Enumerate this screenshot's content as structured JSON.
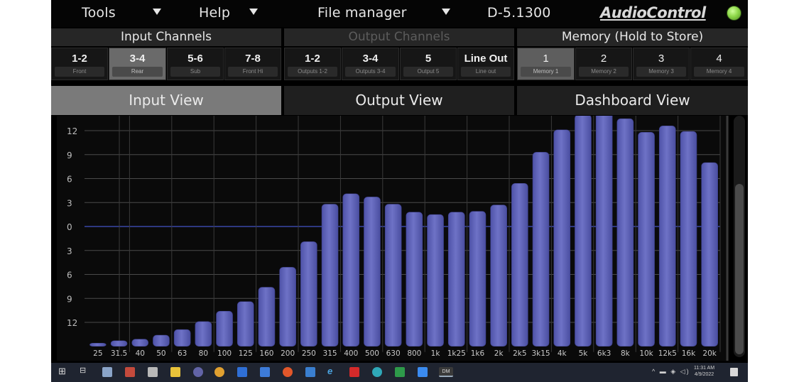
{
  "menu": {
    "tools": "Tools",
    "help": "Help",
    "file_manager": "File manager",
    "device": "D-5.1300",
    "brand": "AudioControl"
  },
  "sections": {
    "input": "Input Channels",
    "output": "Output Channels",
    "memory": "Memory (Hold to Store)"
  },
  "input_channels": [
    {
      "label": "1-2",
      "sub": "Front"
    },
    {
      "label": "3-4",
      "sub": "Rear"
    },
    {
      "label": "5-6",
      "sub": "Sub"
    },
    {
      "label": "7-8",
      "sub": "Front Hi"
    }
  ],
  "output_channels": [
    {
      "label": "1-2",
      "sub": "Outputs 1-2"
    },
    {
      "label": "3-4",
      "sub": "Outputs 3-4"
    },
    {
      "label": "5",
      "sub": "Output 5"
    },
    {
      "label": "Line Out",
      "sub": "Line out"
    }
  ],
  "memory_slots": [
    {
      "label": "1",
      "sub": "Memory 1"
    },
    {
      "label": "2",
      "sub": "Memory 2"
    },
    {
      "label": "3",
      "sub": "Memory 3"
    },
    {
      "label": "4",
      "sub": "Memory 4"
    }
  ],
  "views": {
    "input": "Input View",
    "output": "Output View",
    "dashboard": "Dashboard View"
  },
  "colors": {
    "bar": "#6e72c6",
    "zero_line": "#3b47a8",
    "grid": "#4a4a4a",
    "led": "#8fd94a"
  },
  "chart_data": {
    "type": "bar",
    "categories": [
      "25",
      "31.5",
      "40",
      "50",
      "63",
      "80",
      "100",
      "125",
      "160",
      "200",
      "250",
      "315",
      "400",
      "500",
      "630",
      "800",
      "1k",
      "1k25",
      "1k6",
      "2k",
      "2k5",
      "3k15",
      "4k",
      "5k",
      "6k3",
      "8k",
      "10k",
      "12k5",
      "16k",
      "20k"
    ],
    "values": [
      -14.6,
      -14.3,
      -14.1,
      -13.6,
      -12.9,
      -11.9,
      -10.6,
      -9.4,
      -7.6,
      -5.1,
      -1.9,
      2.8,
      4.1,
      3.7,
      2.8,
      1.8,
      1.5,
      1.8,
      1.9,
      2.7,
      5.4,
      9.3,
      12.1,
      14.0,
      14.7,
      13.5,
      11.8,
      12.6,
      11.9,
      8.0
    ],
    "y_tick_labels": [
      "12",
      "9",
      "6",
      "3",
      "0",
      "3",
      "6",
      "9",
      "12"
    ],
    "ylim": [
      -15,
      14
    ],
    "y_ticks": [
      12,
      9,
      6,
      3,
      0,
      -3,
      -6,
      -9,
      -12
    ],
    "grid": true
  },
  "taskbar": {
    "time": "11:31 AM",
    "date": "4/9/2022",
    "app_badge": "DM"
  }
}
